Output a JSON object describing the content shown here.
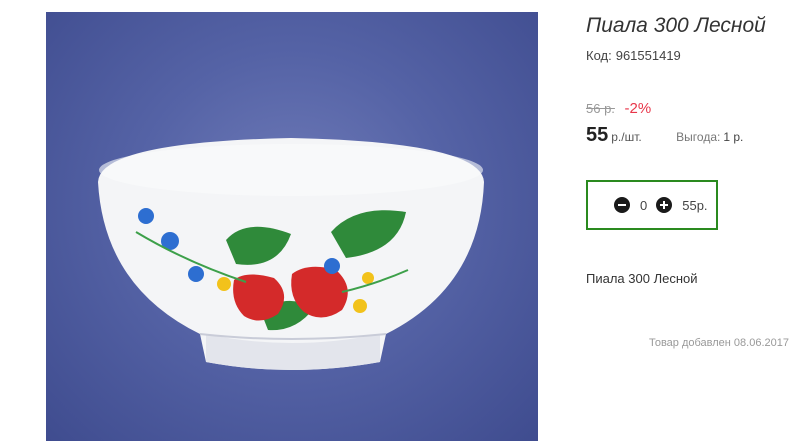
{
  "product": {
    "title": "Пиала 300 Лесной",
    "code_label": "Код:",
    "code_value": "961551419",
    "old_price": "56 р.",
    "discount": "-2%",
    "price": "55",
    "price_unit": "р./шт.",
    "benefit_label": "Выгода:",
    "benefit_value": "1 р.",
    "description": "Пиала 300 Лесной",
    "added_text": "Товар добавлен 08.06.2017"
  },
  "cart": {
    "quantity": "0",
    "sum": "55р.",
    "minus_icon": "minus-circle-icon",
    "plus_icon": "plus-circle-icon"
  },
  "colors": {
    "accent_border": "#2a8a1f",
    "discount": "#e8364a",
    "photo_bg": "#5563a6"
  }
}
